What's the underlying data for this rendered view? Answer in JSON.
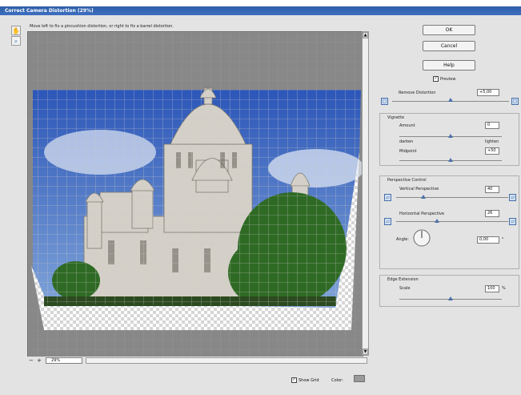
{
  "window": {
    "title": "Correct Camera Distortion (29%)"
  },
  "hint": "Move left to fix a pincushion distortion, or right to fix a barrel distortion.",
  "buttons": {
    "ok": "OK",
    "cancel": "Cancel",
    "help": "Help"
  },
  "preview_toggle": {
    "label": "Preview",
    "checked": true
  },
  "remove_distortion": {
    "label": "Remove Distortion",
    "value": "+5,00"
  },
  "vignette": {
    "title": "Vignette",
    "amount_label": "Amount",
    "amount_value": "0",
    "darken_label": "darken",
    "lighten_label": "lighten",
    "midpoint_label": "Midpoint",
    "midpoint_value": "+50"
  },
  "perspective": {
    "title": "Perspective Control",
    "vertical_label": "Vertical Perspective",
    "vertical_value": "40",
    "horizontal_label": "Horizontal Perspective",
    "horizontal_value": "26",
    "angle_label": "Angle:",
    "angle_value": "0,00",
    "angle_unit": "°"
  },
  "edge": {
    "title": "Edge Extension",
    "scale_label": "Scale",
    "scale_value": "100",
    "scale_unit": "%"
  },
  "bottom": {
    "zoom_value": "29%",
    "show_grid_label": "Show Grid",
    "show_grid_checked": true,
    "color_label": "Color:"
  },
  "icons": {
    "tools": [
      "hand-tool-icon",
      "zoom-tool-icon"
    ],
    "distortion": [
      "pincushion-icon",
      "barrel-icon"
    ],
    "perspective": [
      "vertical-left-icon",
      "vertical-right-icon",
      "horizontal-left-icon",
      "horizontal-right-icon"
    ]
  },
  "colors": {
    "title_bar": "#3d6fc0",
    "accent": "#4a6fa8",
    "grid_color": "#9a9a9a"
  }
}
